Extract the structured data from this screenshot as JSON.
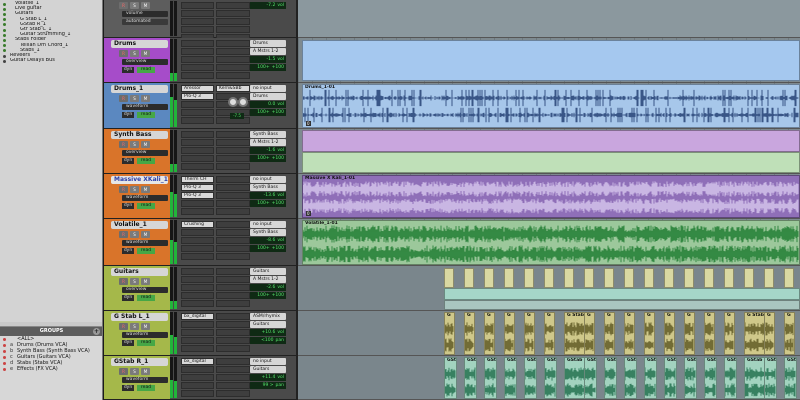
{
  "tracklist": {
    "items": [
      {
        "label": "Volatile_1",
        "indent": 1,
        "shown": true
      },
      {
        "label": "Live guitar",
        "indent": 1,
        "shown": true
      },
      {
        "label": "Guitars",
        "indent": 1,
        "shown": true
      },
      {
        "label": "G Stab L_1",
        "indent": 2,
        "shown": true
      },
      {
        "label": "GStab R_1",
        "indent": 2,
        "shown": true
      },
      {
        "label": "Gtr Stab C_1",
        "indent": 2,
        "shown": true
      },
      {
        "label": "Guitar Strumming_1",
        "indent": 2,
        "shown": true
      },
      {
        "label": "Stabs Folder",
        "indent": 1,
        "shown": true
      },
      {
        "label": "Tellian Dm Chord_1",
        "indent": 2,
        "shown": true
      },
      {
        "label": "Stabs_1",
        "indent": 2,
        "shown": true
      },
      {
        "label": "Reveers",
        "indent": 0,
        "shown": false
      },
      {
        "label": "Guitar Delays Bus",
        "indent": 0,
        "shown": false
      }
    ]
  },
  "groups": {
    "title": "GROUPS",
    "add_label": "+",
    "items": [
      {
        "letter": "",
        "label": "<ALL>"
      },
      {
        "letter": "a",
        "label": "Drums (Drums VCA)"
      },
      {
        "letter": "b",
        "label": "Synth Bass (Synth Bass VCA)"
      },
      {
        "letter": "c",
        "label": "Guitars (Guitars VCA)"
      },
      {
        "letter": "d",
        "label": "Stabs (Stabs VCA)"
      },
      {
        "letter": "e",
        "label": "Effects (FX VCA)"
      }
    ]
  },
  "buttons": {
    "rec": "R",
    "solo": "S",
    "mute": "M"
  },
  "tracks": [
    {
      "id": "top",
      "name": "",
      "color": "#5d5d5d",
      "view": "volume",
      "dyn": "",
      "mode": "",
      "inserts": [],
      "sends": [],
      "io": [],
      "vol": [
        {
          "label": "vol",
          "value": "-7.2"
        }
      ],
      "auto": "automated",
      "meter": 0
    },
    {
      "id": "drums",
      "name": "Drums",
      "color": "#a64cc9",
      "view": "overview",
      "dyn": "dyn",
      "mode": "read",
      "inserts": [],
      "sends": [],
      "io": [
        "Drums",
        "A Mstrs 1-2"
      ],
      "vol": [
        {
          "label": "vol",
          "value": "-1.5"
        },
        {
          "label": "+100",
          "value": "100+"
        }
      ],
      "meter": 0.2
    },
    {
      "id": "drums1",
      "name": "Drums_1",
      "color": "#5b88c0",
      "view": "waveform",
      "dyn": "dyn",
      "mode": "read",
      "inserts": [
        "Aressor",
        "Pro-Q 3"
      ],
      "sends": [
        "Kern&SBb"
      ],
      "io": [
        "no input",
        "Drums"
      ],
      "vol": [
        {
          "label": "vol",
          "value": "0.0"
        },
        {
          "label": "+100",
          "value": "100+"
        }
      ],
      "knob": "-7.5",
      "meter": 0.7
    },
    {
      "id": "synthbass",
      "name": "Synth Bass",
      "color": "#d9742a",
      "view": "overview",
      "dyn": "dyn",
      "mode": "read",
      "inserts": [],
      "sends": [],
      "io": [
        "Synth Bass",
        "A Mstrs 1-2"
      ],
      "vol": [
        {
          "label": "vol",
          "value": "-1.6"
        },
        {
          "label": "+100",
          "value": "100+"
        }
      ],
      "meter": 0.2
    },
    {
      "id": "massive",
      "name": "Massive XKali_1",
      "color": "#d9742a",
      "view": "waveform",
      "dyn": "dyn",
      "mode": "read",
      "inserts": [
        "Therm CH",
        "Pro-Q 3",
        "Pro-Q 3"
      ],
      "sends": [],
      "io": [
        "no input",
        "Synth Bass"
      ],
      "vol": [
        {
          "label": "vol",
          "value": "-13.6"
        },
        {
          "label": "+100",
          "value": "100+"
        }
      ],
      "selected": true,
      "meter": 0.6
    },
    {
      "id": "volatile",
      "name": "Volatile_1",
      "color": "#d9742a",
      "view": "waveform",
      "dyn": "dyn",
      "mode": "read",
      "inserts": [
        "Crushing"
      ],
      "sends": [],
      "io": [
        "no input",
        "Synth Bass"
      ],
      "vol": [
        {
          "label": "vol",
          "value": "-8.6"
        },
        {
          "label": "+100",
          "value": "100+"
        }
      ],
      "meter": 0.55
    },
    {
      "id": "guitars",
      "name": "Guitars",
      "color": "#a5b84a",
      "view": "overview",
      "dyn": "dyn",
      "mode": "read",
      "inserts": [],
      "sends": [],
      "io": [
        "Guitars",
        "A Mstrs 1-2"
      ],
      "vol": [
        {
          "label": "vol",
          "value": "-2.6"
        },
        {
          "label": "+100",
          "value": "100+"
        }
      ],
      "meter": 0.2
    },
    {
      "id": "gstabl",
      "name": "G Stab L_1",
      "color": "#a5b84a",
      "view": "waveform",
      "dyn": "dyn",
      "mode": "read",
      "inserts": [
        "bx_digital"
      ],
      "sends": [],
      "io": [
        "ASM/rhymix",
        "Guitars"
      ],
      "vol": [
        {
          "label": "vol",
          "value": "+10.6"
        },
        {
          "label": "pan",
          "value": "<100"
        }
      ],
      "meter": 0.45
    },
    {
      "id": "gstabr",
      "name": "GStab R_1",
      "color": "#a5b84a",
      "view": "waveform",
      "dyn": "dyn",
      "mode": "read",
      "inserts": [
        "bx_digital"
      ],
      "sends": [],
      "io": [
        "no input",
        "Guitars"
      ],
      "vol": [
        {
          "label": "vol",
          "value": "+11.4"
        },
        {
          "label": "pan",
          "value": "99 >"
        }
      ],
      "meter": 0.45
    }
  ],
  "clips": {
    "drums": "Drums_1-01",
    "massive": "Massive X Kali_1-01",
    "volatile": "Volatile_1-01",
    "gstab_l": "G Stab L",
    "gstab_r": "GStab R",
    "g_short": "G",
    "gs_short": "GSt",
    "clip_num": "0"
  },
  "colors": {
    "drums_folder": "#a5c8ef",
    "drums_clip": "#a7c7ea",
    "synth_folder_top": "#c9a6de",
    "synth_folder_bot": "#bfe0b8",
    "massive_clip": "#8f6fb8",
    "volatile_clip": "#9cc89b",
    "guitar_folder": "#d9d8a2",
    "guitar_aqua": "#a5d6c8",
    "gstab_clip": "#cfc88a",
    "gstabr_clip": "#a2d3bf"
  }
}
